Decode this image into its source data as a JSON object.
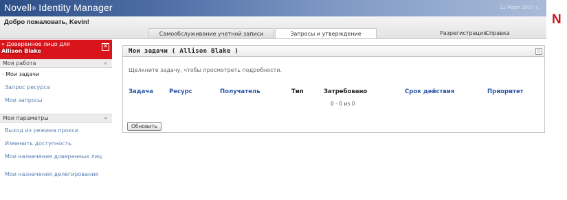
{
  "header": {
    "title": "Novell",
    "title_mark": "®",
    "title_rest": " Identity Manager",
    "date": "11 Март 2007 г.",
    "brand_letter": "N",
    "welcome": "Добро пожаловать, Kevin!"
  },
  "tabs": {
    "selfservice": "Самообслуживание учетной записи",
    "requests": "Запросы и утверждение",
    "logout": "Разрегистрация",
    "help": "Справка"
  },
  "sidebar": {
    "proxy_label": "» Доверенное лицо для",
    "proxy_user": "Allison Blake",
    "close_glyph": "✕",
    "work_section": {
      "title": "Моя работа",
      "collapse_glyph": "«",
      "items": [
        "Мои задачи",
        "Запрос ресурса",
        "Мои запросы"
      ]
    },
    "settings_section": {
      "title": "Мои параметры",
      "collapse_glyph": "«",
      "items": [
        "Выход из режима прокси",
        "Изменить доступность",
        "Мои назначения доверенных лиц",
        "Мои назначения делегирования"
      ]
    }
  },
  "panel": {
    "title": "Мои задачи ( Allison Blake )",
    "menu_glyph": "⁞⁞",
    "hint": "Щелкните задачу, чтобы просмотреть подробности.",
    "columns": [
      "Задача",
      "Ресурс",
      "Получатель",
      "Тип",
      "Затребовано",
      "Срок действия",
      "Приоритет"
    ],
    "count": "0 - 0 из 0",
    "refresh_label": "Обновить"
  }
}
